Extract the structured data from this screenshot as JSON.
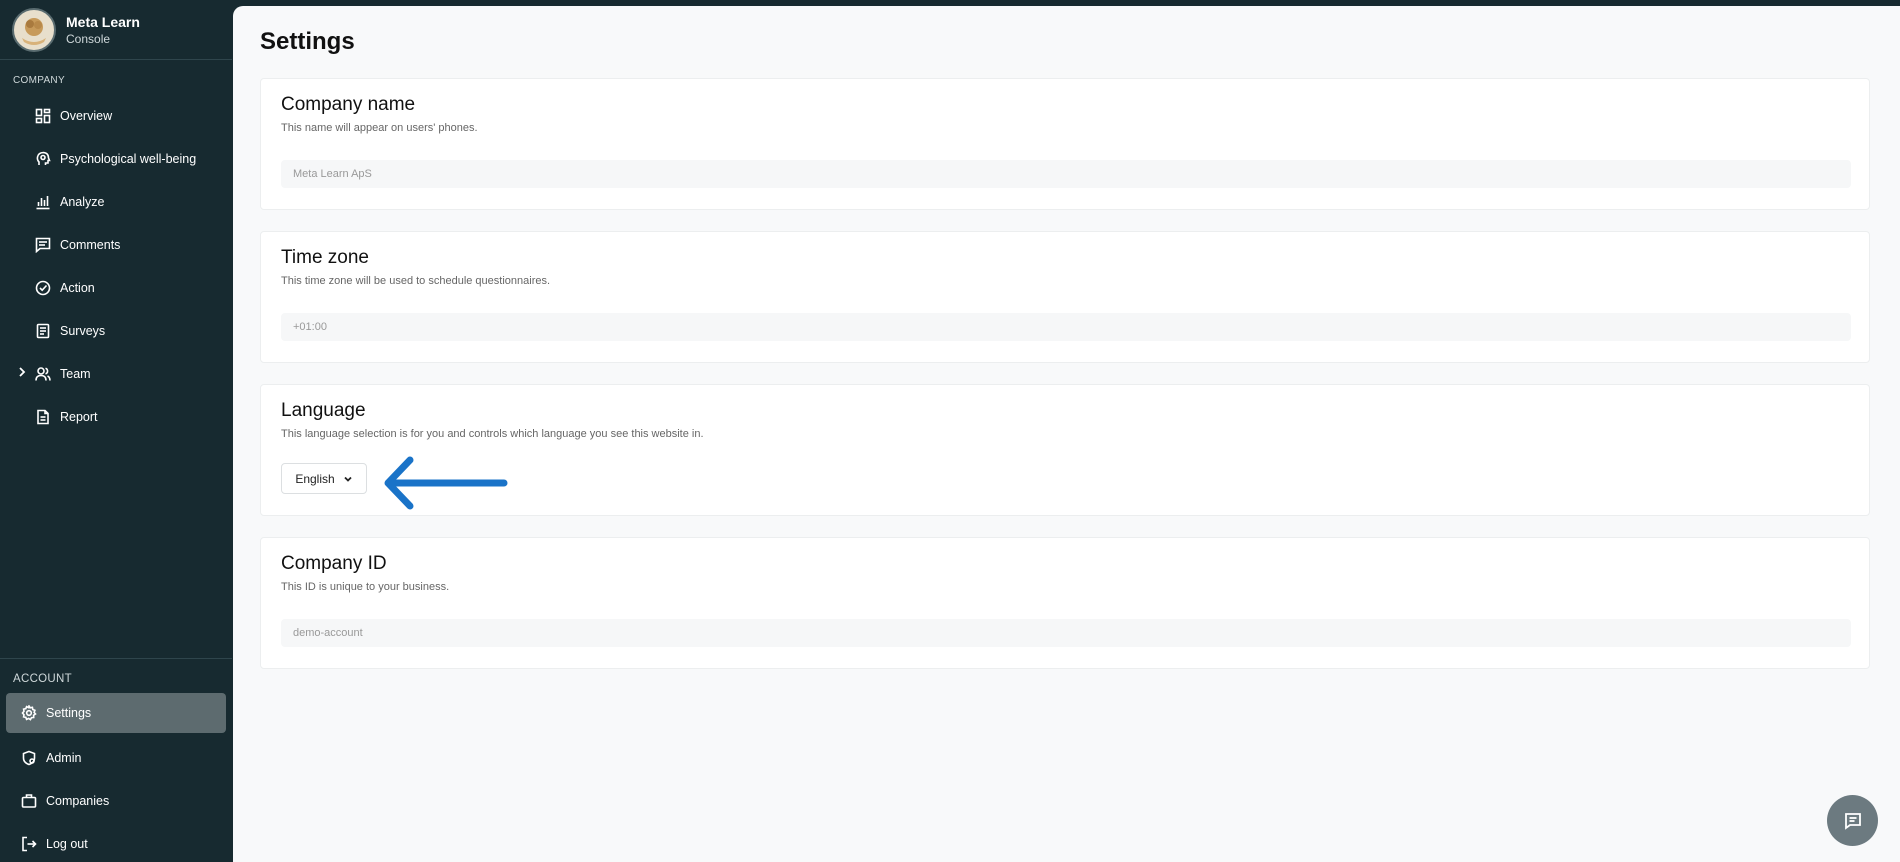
{
  "brand": {
    "name": "Meta Learn",
    "subtitle": "Console"
  },
  "sidebar": {
    "company_section": "COMPANY",
    "items": [
      {
        "label": "Overview",
        "icon": "dashboard-icon"
      },
      {
        "label": "Psychological well-being",
        "icon": "head-icon"
      },
      {
        "label": "Analyze",
        "icon": "bar-chart-icon"
      },
      {
        "label": "Comments",
        "icon": "comment-icon"
      },
      {
        "label": "Action",
        "icon": "check-circle-icon"
      },
      {
        "label": "Surveys",
        "icon": "clipboard-icon"
      },
      {
        "label": "Team",
        "icon": "users-icon",
        "expandable": true
      },
      {
        "label": "Report",
        "icon": "document-icon"
      }
    ],
    "account_section": "ACCOUNT",
    "account_items": [
      {
        "label": "Settings",
        "icon": "gear-icon",
        "active": true
      },
      {
        "label": "Admin",
        "icon": "shield-icon"
      },
      {
        "label": "Companies",
        "icon": "briefcase-icon"
      },
      {
        "label": "Log out",
        "icon": "logout-icon"
      }
    ]
  },
  "main": {
    "title": "Settings",
    "cards": {
      "company_name": {
        "title": "Company name",
        "description": "This name will appear on users' phones.",
        "value": "Meta Learn ApS"
      },
      "time_zone": {
        "title": "Time zone",
        "description": "This time zone will be used to schedule questionnaires.",
        "value": "+01:00"
      },
      "language": {
        "title": "Language",
        "description": "This language selection is for you and controls which language you see this website in.",
        "selected": "English"
      },
      "company_id": {
        "title": "Company ID",
        "description": "This ID is unique to your business.",
        "value": "demo-account"
      }
    }
  },
  "colors": {
    "sidebar": "#172a30",
    "active_item": "#5d6b6f",
    "arrow": "#1a73c8"
  }
}
